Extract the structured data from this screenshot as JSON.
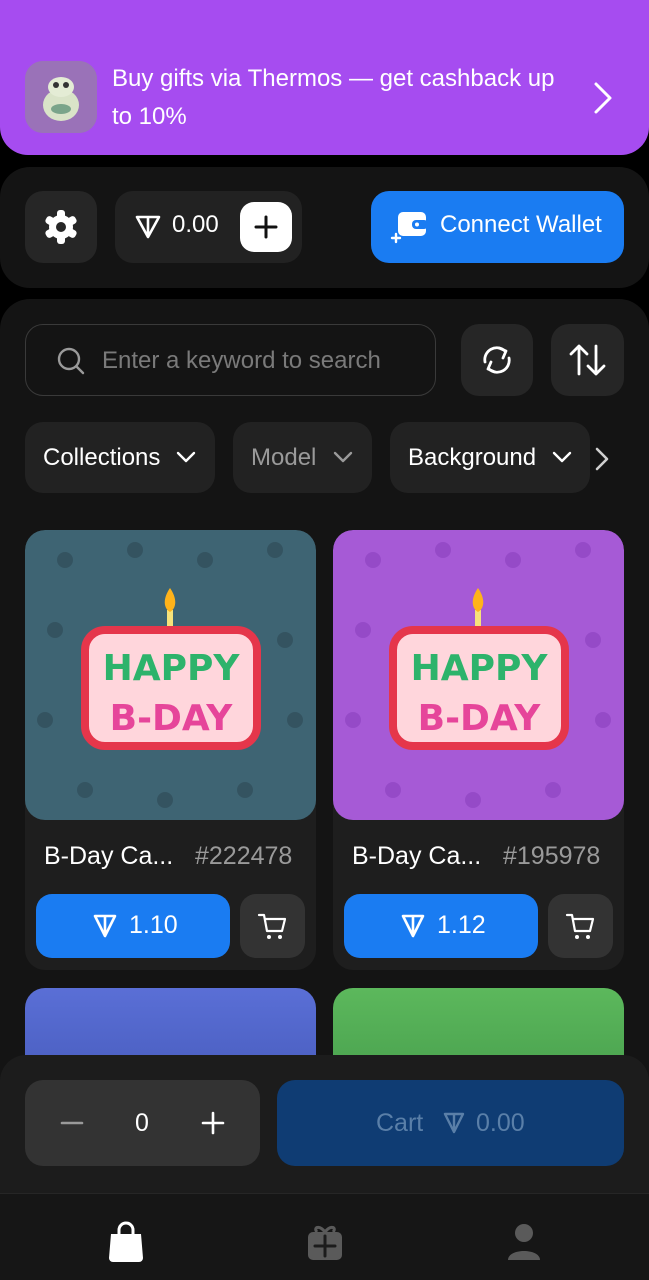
{
  "banner": {
    "text": "Buy gifts via Thermos — get cashback up to 10%",
    "logo_icon": "frog-logo-icon",
    "arrow_icon": "chevron-right-icon",
    "color": "#a64cf0"
  },
  "header": {
    "settings_icon": "gear-icon",
    "balance": "0.00",
    "currency_icon": "ton-icon",
    "add_icon": "plus-icon",
    "connect_wallet_label": "Connect Wallet",
    "wallet_icon": "wallet-icon",
    "accent": "#1a7cf2"
  },
  "search": {
    "placeholder": "Enter a keyword to search",
    "value": "",
    "refresh_icon": "refresh-icon",
    "sort_icon": "sort-arrows-icon"
  },
  "filters": [
    {
      "label": "Collections"
    },
    {
      "label": "Model"
    },
    {
      "label": "Background"
    }
  ],
  "gifts": [
    {
      "name": "B-Day Ca...",
      "number": "#222478",
      "price": "1.10",
      "background": "#3e6473",
      "image_icon": "happy-bday-candle-icon"
    },
    {
      "name": "B-Day Ca...",
      "number": "#195978",
      "price": "1.12",
      "background": "#a65ad6",
      "image_icon": "happy-bday-candle-icon"
    }
  ],
  "cart_bar": {
    "quantity": "0",
    "cart_label": "Cart",
    "cart_total": "0.00"
  },
  "tabs": [
    {
      "icon": "shopping-bag-icon",
      "active": true
    },
    {
      "icon": "gift-icon",
      "active": false
    },
    {
      "icon": "profile-icon",
      "active": false
    }
  ]
}
